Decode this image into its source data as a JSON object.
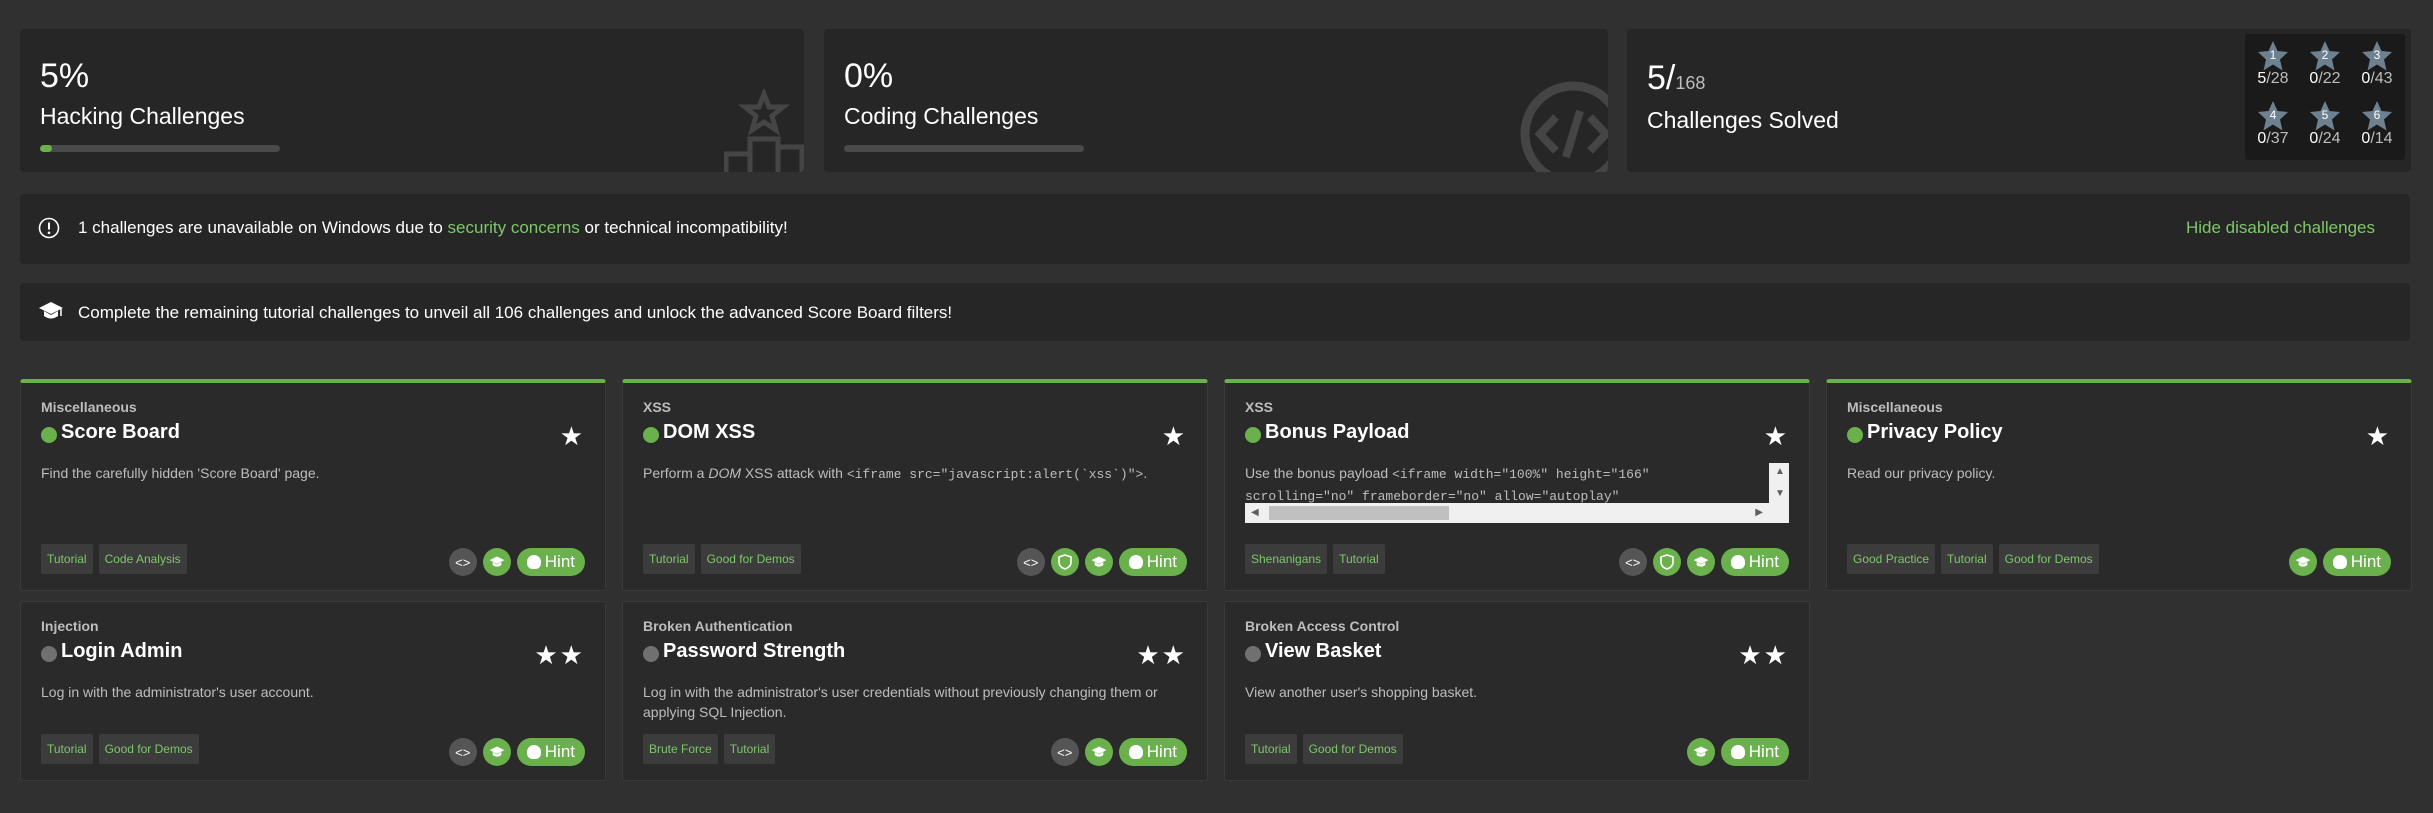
{
  "stats": {
    "hacking": {
      "percent": "5%",
      "label": "Hacking Challenges",
      "progress": 0.05
    },
    "coding": {
      "percent": "0%",
      "label": "Coding Challenges",
      "progress": 0.0
    },
    "solved": {
      "count": "5/",
      "total": "168",
      "label": "Challenges Solved"
    }
  },
  "difficulty": [
    {
      "level": "1",
      "solved": "5",
      "total": "/28"
    },
    {
      "level": "2",
      "solved": "0",
      "total": "/22"
    },
    {
      "level": "3",
      "solved": "0",
      "total": "/43"
    },
    {
      "level": "4",
      "solved": "0",
      "total": "/37"
    },
    {
      "level": "5",
      "solved": "0",
      "total": "/24"
    },
    {
      "level": "6",
      "solved": "0",
      "total": "/14"
    }
  ],
  "banner_windows": {
    "text_before": "1 challenges are unavailable on Windows due to ",
    "link": "security concerns",
    "text_after": " or technical incompatibility!",
    "hide_button": "Hide disabled challenges"
  },
  "banner_tutorial": {
    "text": "Complete the remaining tutorial challenges to unveil all 106 challenges and unlock the advanced Score Board filters!"
  },
  "cards": [
    {
      "category": "Miscellaneous",
      "title": "Score Board",
      "stars": "★",
      "solved": true,
      "description": "Find the carefully hidden 'Score Board' page.",
      "tags": [
        "Tutorial",
        "Code Analysis"
      ],
      "hint": "Hint"
    },
    {
      "category": "XSS",
      "title": "DOM XSS",
      "stars": "★",
      "solved": true,
      "desc_prefix": "Perform a ",
      "desc_em": "DOM",
      "desc_mid": " XSS attack with ",
      "desc_code": "<iframe src=\"javascript:alert(`xss`)\">",
      "desc_suffix": ".",
      "tags": [
        "Tutorial",
        "Good for Demos"
      ],
      "hint": "Hint"
    },
    {
      "category": "XSS",
      "title": "Bonus Payload",
      "stars": "★",
      "solved": true,
      "desc_line1_prefix": "Use the bonus payload ",
      "desc_line1_code": "<iframe width=\"100%\" height=\"166\"",
      "desc_line2_code": "scrolling=\"no\" frameborder=\"no\" allow=\"autoplay\"",
      "tags": [
        "Shenanigans",
        "Tutorial"
      ],
      "hint": "Hint"
    },
    {
      "category": "Miscellaneous",
      "title": "Privacy Policy",
      "stars": "★",
      "solved": true,
      "description": "Read our privacy policy.",
      "tags": [
        "Good Practice",
        "Tutorial",
        "Good for Demos"
      ],
      "hint": "Hint"
    },
    {
      "category": "Injection",
      "title": "Login Admin",
      "stars": "★★",
      "solved": false,
      "description": "Log in with the administrator's user account.",
      "tags": [
        "Tutorial",
        "Good for Demos"
      ],
      "hint": "Hint"
    },
    {
      "category": "Broken Authentication",
      "title": "Password Strength",
      "stars": "★★",
      "solved": false,
      "description": "Log in with the administrator's user credentials without previously changing them or applying SQL Injection.",
      "tags": [
        "Brute Force",
        "Tutorial"
      ],
      "hint": "Hint"
    },
    {
      "category": "Broken Access Control",
      "title": "View Basket",
      "stars": "★★",
      "solved": false,
      "description": "View another user's shopping basket.",
      "tags": [
        "Tutorial",
        "Good for Demos"
      ],
      "hint": "Hint"
    }
  ],
  "colors": {
    "accent": "#6ab04c",
    "background": "#303030",
    "panel": "#262626",
    "card": "#2a2a2a"
  }
}
